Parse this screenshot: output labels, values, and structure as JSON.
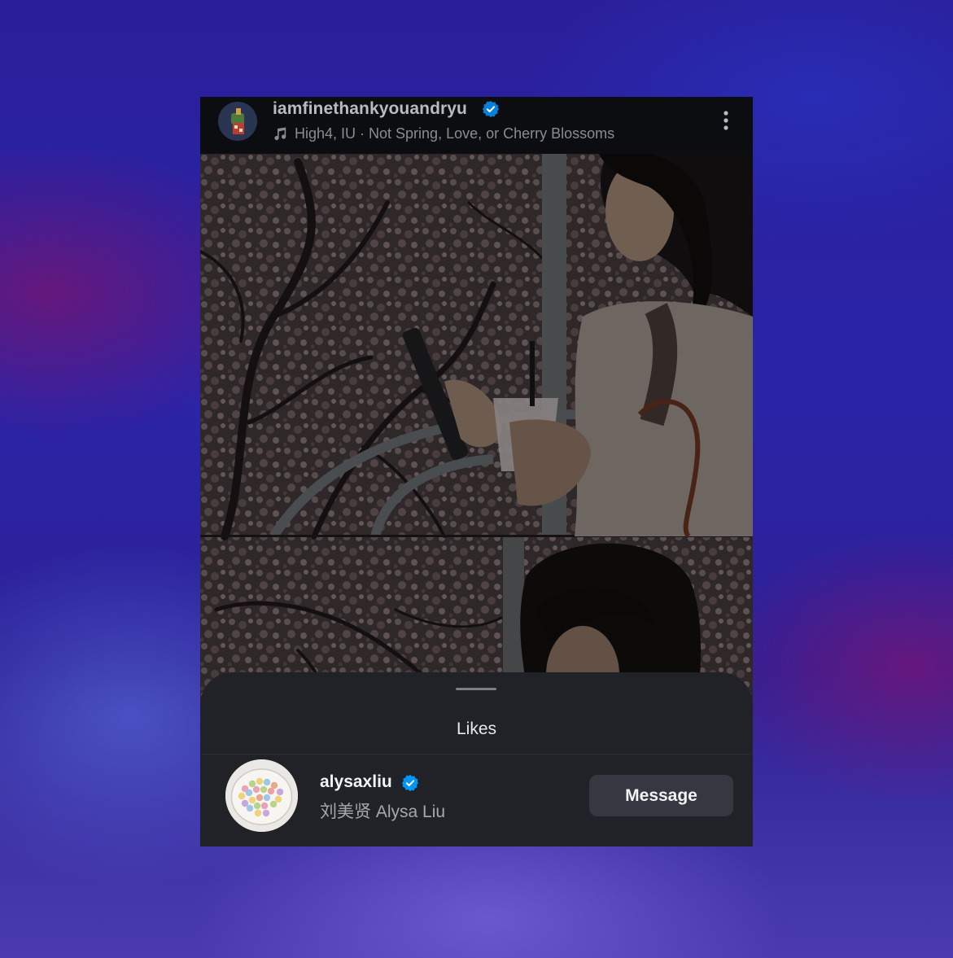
{
  "post": {
    "username": "iamfinethankyouandryu",
    "song": "High4, IU · Not Spring, Love, or Cherry Blossoms",
    "icons": {
      "avatar": "profile-avatar",
      "verified": "verified-badge-icon",
      "music": "music-note-icon",
      "more": "more-options-icon"
    },
    "image": "cherry-blossom-photo"
  },
  "likes_sheet": {
    "title": "Likes",
    "items": [
      {
        "username": "alysaxliu",
        "full_name": "刘美贤 Alysa Liu",
        "verified": true,
        "button_label": "Message"
      }
    ]
  },
  "colors": {
    "verified": "#0095f6",
    "sheet_bg": "#212227",
    "button_bg": "#353840"
  }
}
